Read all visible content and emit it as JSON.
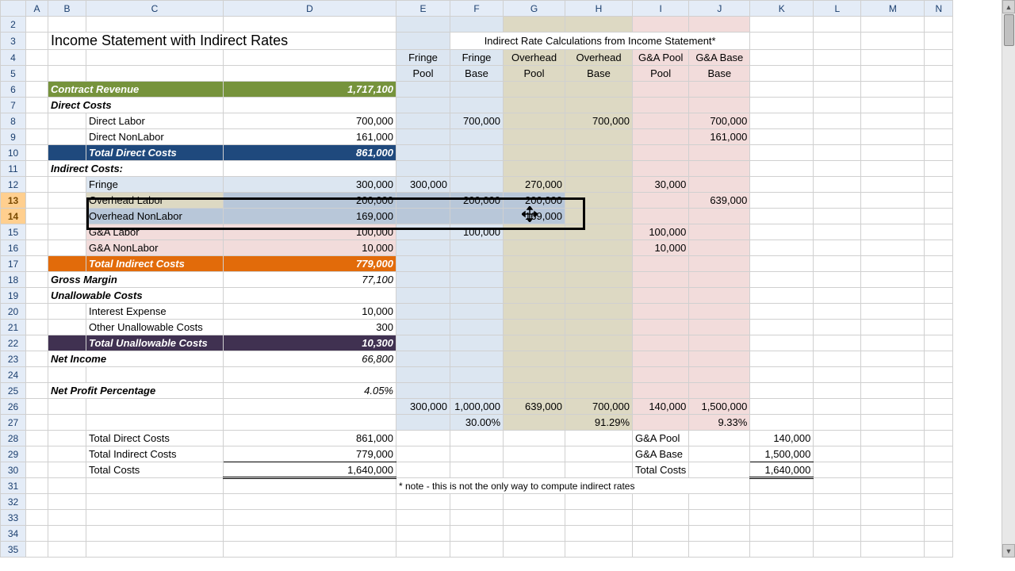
{
  "columns": [
    "A",
    "B",
    "C",
    "D",
    "E",
    "F",
    "G",
    "H",
    "I",
    "J",
    "K",
    "L",
    "M",
    "N"
  ],
  "title": "Income Statement with Indirect Rates",
  "calc_title": "Indirect Rate Calculations from Income Statement*",
  "headers": {
    "E1": "Fringe",
    "E2": "Pool",
    "F1": "Fringe",
    "F2": "Base",
    "G1": "Overhead",
    "G2": "Pool",
    "H1": "Overhead",
    "H2": "Base",
    "I1": "G&A Pool",
    "I2": "Pool",
    "J1": "G&A Base",
    "J2": "Base"
  },
  "rows": {
    "r6": {
      "label": "Contract Revenue",
      "val": "1,717,100"
    },
    "r7": {
      "label": "Direct Costs"
    },
    "r8": {
      "label": "Direct Labor",
      "val": "700,000",
      "F": "700,000",
      "H": "700,000",
      "J": "700,000"
    },
    "r9": {
      "label": "Direct NonLabor",
      "val": "161,000",
      "J": "161,000"
    },
    "r10": {
      "label": "Total Direct Costs",
      "val": "861,000"
    },
    "r11": {
      "label": "Indirect Costs:"
    },
    "r12": {
      "label": "Fringe",
      "val": "300,000",
      "E": "300,000",
      "G": "270,000",
      "I": "30,000"
    },
    "r13": {
      "label": "Overhead Labor",
      "val": "200,000",
      "F": "200,000",
      "G": "200,000",
      "J": "639,000"
    },
    "r14": {
      "label": "Overhead NonLabor",
      "val": "169,000",
      "G": "169,000"
    },
    "r15": {
      "label": "G&A Labor",
      "val": "100,000",
      "F": "100,000",
      "I": "100,000"
    },
    "r16": {
      "label": "G&A NonLabor",
      "val": "10,000",
      "I": "10,000"
    },
    "r17": {
      "label": "Total Indirect Costs",
      "val": "779,000"
    },
    "r18": {
      "label": "Gross Margin",
      "val": "77,100"
    },
    "r19": {
      "label": "Unallowable Costs"
    },
    "r20": {
      "label": "Interest Expense",
      "val": "10,000"
    },
    "r21": {
      "label": "Other Unallowable Costs",
      "val": "300"
    },
    "r22": {
      "label": "Total Unallowable Costs",
      "val": "10,300"
    },
    "r23": {
      "label": "Net Income",
      "val": "66,800"
    },
    "r25": {
      "label": "Net Profit Percentage",
      "val": "4.05%"
    },
    "r26": {
      "E": "300,000",
      "F": "1,000,000",
      "G": "639,000",
      "H": "700,000",
      "I": "140,000",
      "J": "1,500,000"
    },
    "r27": {
      "F": "30.00%",
      "H": "91.29%",
      "J": "9.33%"
    },
    "r28": {
      "label": "Total Direct Costs",
      "val": "861,000",
      "I": "G&A Pool",
      "K": "140,000"
    },
    "r29": {
      "label": "Total Indirect Costs",
      "val": "779,000",
      "I": "G&A Base",
      "K": "1,500,000"
    },
    "r30": {
      "label": "Total Costs",
      "val": "1,640,000",
      "I": "Total Costs",
      "K": "1,640,000"
    },
    "r31": {
      "note": "* note - this is not the only way to compute indirect rates"
    }
  },
  "chart_data": {
    "type": "table",
    "title": "Income Statement with Indirect Rates",
    "income_statement": {
      "contract_revenue": 1717100,
      "direct_costs": {
        "direct_labor": 700000,
        "direct_nonlabor": 161000,
        "total": 861000
      },
      "indirect_costs": {
        "fringe": 300000,
        "overhead_labor": 200000,
        "overhead_nonlabor": 169000,
        "ga_labor": 100000,
        "ga_nonlabor": 10000,
        "total": 779000
      },
      "gross_margin": 77100,
      "unallowable_costs": {
        "interest_expense": 10000,
        "other": 300,
        "total": 10300
      },
      "net_income": 66800,
      "net_profit_pct": 4.05
    },
    "indirect_rates": {
      "fringe": {
        "pool": 300000,
        "base": 1000000,
        "rate_pct": 30.0
      },
      "overhead": {
        "pool": 639000,
        "base": 700000,
        "rate_pct": 91.29
      },
      "ga": {
        "pool": 140000,
        "base": 1500000,
        "rate_pct": 9.33
      }
    },
    "totals": {
      "total_direct": 861000,
      "total_indirect": 779000,
      "total_costs": 1640000
    }
  }
}
